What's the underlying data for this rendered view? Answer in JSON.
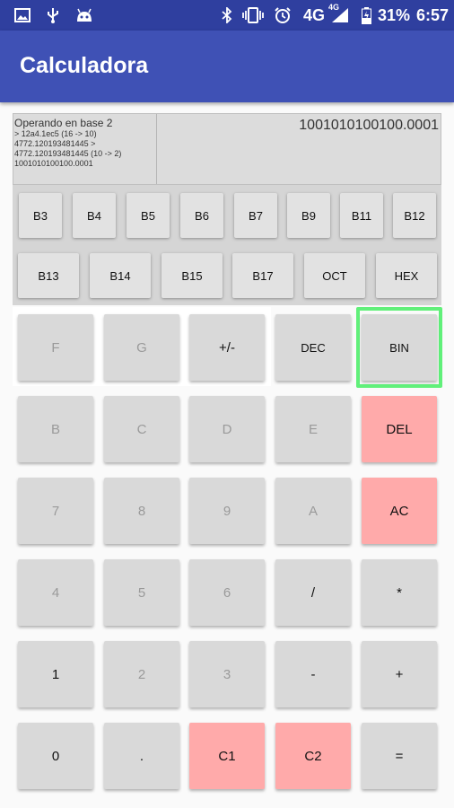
{
  "status_bar": {
    "network": "4G",
    "network_badge": "4G",
    "battery": "31%",
    "time": "6:57",
    "icons": [
      "image-icon",
      "usb-icon",
      "android-icon",
      "bluetooth-icon",
      "vibrate-icon",
      "alarm-icon",
      "signal-icon",
      "battery-icon"
    ]
  },
  "app": {
    "title": "Calculadora"
  },
  "display": {
    "mode": "Operando en base 2",
    "history": [
      "> 12a4.1ec5 (16 -> 10)",
      "4772.120193481445 >",
      "4772.120193481445 (10 -> 2)",
      "1001010100100.0001"
    ],
    "result": "1001010100100.0001"
  },
  "bases": {
    "row1": [
      "B3",
      "B4",
      "B5",
      "B6",
      "B7",
      "B9",
      "B11",
      "B12"
    ],
    "row2": [
      "B13",
      "B14",
      "B15",
      "B17",
      "OCT",
      "HEX"
    ]
  },
  "keypad": {
    "row1": [
      "F",
      "G",
      "+/-",
      "DEC",
      "BIN"
    ],
    "row2": [
      "B",
      "C",
      "D",
      "E",
      "DEL"
    ],
    "row3": [
      "7",
      "8",
      "9",
      "A",
      "AC"
    ],
    "row4": [
      "4",
      "5",
      "6",
      "/",
      "*"
    ],
    "row5": [
      "1",
      "2",
      "3",
      "-",
      "+"
    ],
    "row6": [
      "0",
      ".",
      "C1",
      "C2",
      "="
    ]
  },
  "colors": {
    "status_bar": "#2f3f9f",
    "app_bar": "#3f51b5",
    "danger_key": "#ffaaaa",
    "selected_outline": "#61f07a"
  }
}
